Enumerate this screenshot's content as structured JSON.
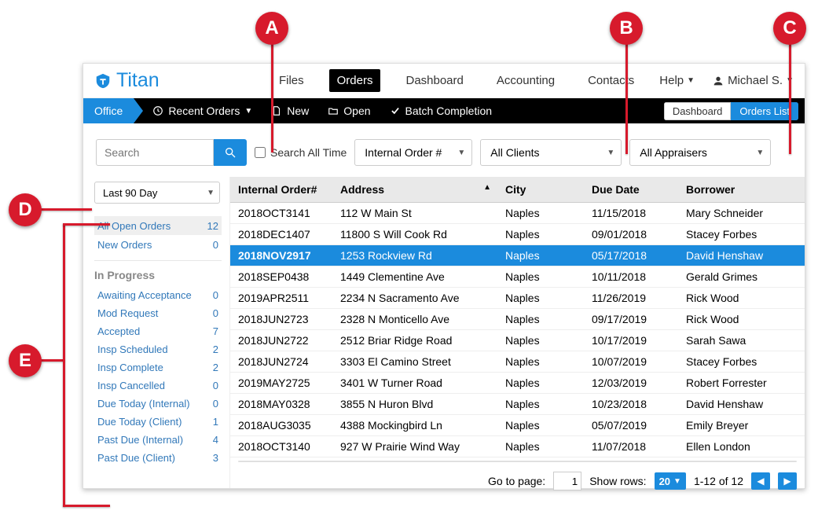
{
  "brand": {
    "name": "Titan"
  },
  "callouts": {
    "a": "A",
    "b": "B",
    "c": "C",
    "d": "D",
    "e": "E"
  },
  "topnav": {
    "files": "Files",
    "orders": "Orders",
    "dashboard": "Dashboard",
    "accounting": "Accounting",
    "contacts": "Contacts",
    "help": "Help",
    "user": "Michael S."
  },
  "subbar": {
    "office": "Office",
    "recent": "Recent Orders",
    "new": "New",
    "open": "Open",
    "batch": "Batch Completion",
    "toggle_left": "Dashboard",
    "toggle_right": "Orders List"
  },
  "toolbar": {
    "search_placeholder": "Search",
    "search_all_time": "Search All Time",
    "order_col": "Internal Order #",
    "clients": "All Clients",
    "appraisers": "All Appraisers"
  },
  "sidebar": {
    "range": "Last 90 Day",
    "top": [
      {
        "label": "All Open Orders",
        "count": 12,
        "active": true
      },
      {
        "label": "New Orders",
        "count": 0,
        "active": false
      }
    ],
    "heading": "In Progress",
    "items": [
      {
        "label": "Awaiting Acceptance",
        "count": 0
      },
      {
        "label": "Mod Request",
        "count": 0
      },
      {
        "label": "Accepted",
        "count": 7
      },
      {
        "label": "Insp Scheduled",
        "count": 2
      },
      {
        "label": "Insp Complete",
        "count": 2
      },
      {
        "label": "Insp Cancelled",
        "count": 0
      },
      {
        "label": "Due Today (Internal)",
        "count": 0
      },
      {
        "label": "Due Today (Client)",
        "count": 1
      },
      {
        "label": "Past Due (Internal)",
        "count": 4
      },
      {
        "label": "Past Due (Client)",
        "count": 3
      }
    ]
  },
  "table": {
    "columns": {
      "c0": "Internal Order#",
      "c1": "Address",
      "c2": "City",
      "c3": "Due Date",
      "c4": "Borrower"
    },
    "rows": [
      {
        "order": "2018OCT3141",
        "address": "112 W Main St",
        "city": "Naples",
        "due": "11/15/2018",
        "borrower": "Mary Schneider",
        "sel": false
      },
      {
        "order": "2018DEC1407",
        "address": "11800 S Will Cook Rd",
        "city": "Naples",
        "due": "09/01/2018",
        "borrower": "Stacey Forbes",
        "sel": false
      },
      {
        "order": "2018NOV2917",
        "address": "1253 Rockview Rd",
        "city": "Naples",
        "due": "05/17/2018",
        "borrower": "David Henshaw",
        "sel": true
      },
      {
        "order": "2018SEP0438",
        "address": "1449 Clementine Ave",
        "city": "Naples",
        "due": "10/11/2018",
        "borrower": "Gerald Grimes",
        "sel": false
      },
      {
        "order": "2019APR2511",
        "address": "2234 N Sacramento Ave",
        "city": "Naples",
        "due": "11/26/2019",
        "borrower": "Rick Wood",
        "sel": false
      },
      {
        "order": "2018JUN2723",
        "address": "2328 N Monticello Ave",
        "city": "Naples",
        "due": "09/17/2019",
        "borrower": "Rick Wood",
        "sel": false
      },
      {
        "order": "2018JUN2722",
        "address": "2512 Briar Ridge Road",
        "city": "Naples",
        "due": "10/17/2019",
        "borrower": "Sarah Sawa",
        "sel": false
      },
      {
        "order": "2018JUN2724",
        "address": "3303 El Camino Street",
        "city": "Naples",
        "due": "10/07/2019",
        "borrower": "Stacey Forbes",
        "sel": false
      },
      {
        "order": "2019MAY2725",
        "address": "3401 W Turner Road",
        "city": "Naples",
        "due": "12/03/2019",
        "borrower": "Robert Forrester",
        "sel": false
      },
      {
        "order": "2018MAY0328",
        "address": "3855 N Huron Blvd",
        "city": "Naples",
        "due": "10/23/2018",
        "borrower": "David Henshaw",
        "sel": false
      },
      {
        "order": "2018AUG3035",
        "address": "4388 Mockingbird Ln",
        "city": "Naples",
        "due": "05/07/2019",
        "borrower": "Emily Breyer",
        "sel": false
      },
      {
        "order": "2018OCT3140",
        "address": "927 W Prairie Wind Way",
        "city": "Naples",
        "due": "11/07/2018",
        "borrower": "Ellen London",
        "sel": false
      }
    ]
  },
  "pager": {
    "goto_label": "Go to page:",
    "page": "1",
    "show_rows_label": "Show rows:",
    "rows_value": "20",
    "range": "1-12 of 12"
  }
}
